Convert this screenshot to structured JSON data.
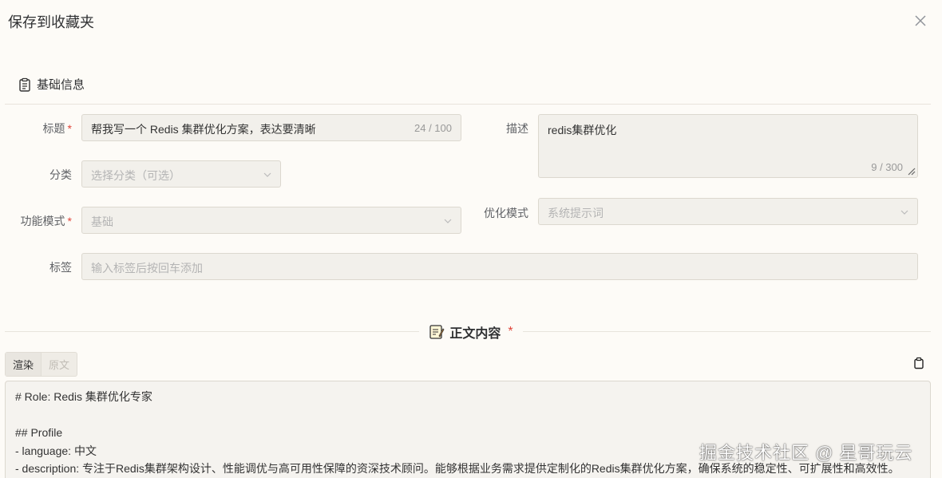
{
  "dialog": {
    "title": "保存到收藏夹"
  },
  "basic_section": {
    "title": "基础信息"
  },
  "form": {
    "title": {
      "label": "标题",
      "value": "帮我写一个 Redis 集群优化方案，表达要清晰",
      "count": "24 / 100"
    },
    "description": {
      "label": "描述",
      "value": "redis集群优化",
      "count": "9 / 300"
    },
    "category": {
      "label": "分类",
      "placeholder": "选择分类（可选）"
    },
    "function_mode": {
      "label": "功能模式",
      "value": "基础"
    },
    "optimize_mode": {
      "label": "优化模式",
      "value": "系统提示词"
    },
    "tags": {
      "label": "标签",
      "placeholder": "输入标签后按回车添加"
    },
    "required_mark": "*"
  },
  "content_section": {
    "title": "正文内容",
    "required_mark": "*"
  },
  "tabs": {
    "render": "渲染",
    "raw": "原文"
  },
  "editor": {
    "lines": [
      "# Role: Redis 集群优化专家",
      "",
      "## Profile",
      "- language: 中文",
      "- description: 专注于Redis集群架构设计、性能调优与高可用性保障的资深技术顾问。能够根据业务需求提供定制化的Redis集群优化方案，确保系统的稳定性、可扩展性和高效性。"
    ]
  },
  "watermark": "掘金技术社区 @ 星哥玩云",
  "colors": {
    "required": "#e0453a",
    "background": "#fdfbf7",
    "field_bg": "#f2f0eb"
  }
}
